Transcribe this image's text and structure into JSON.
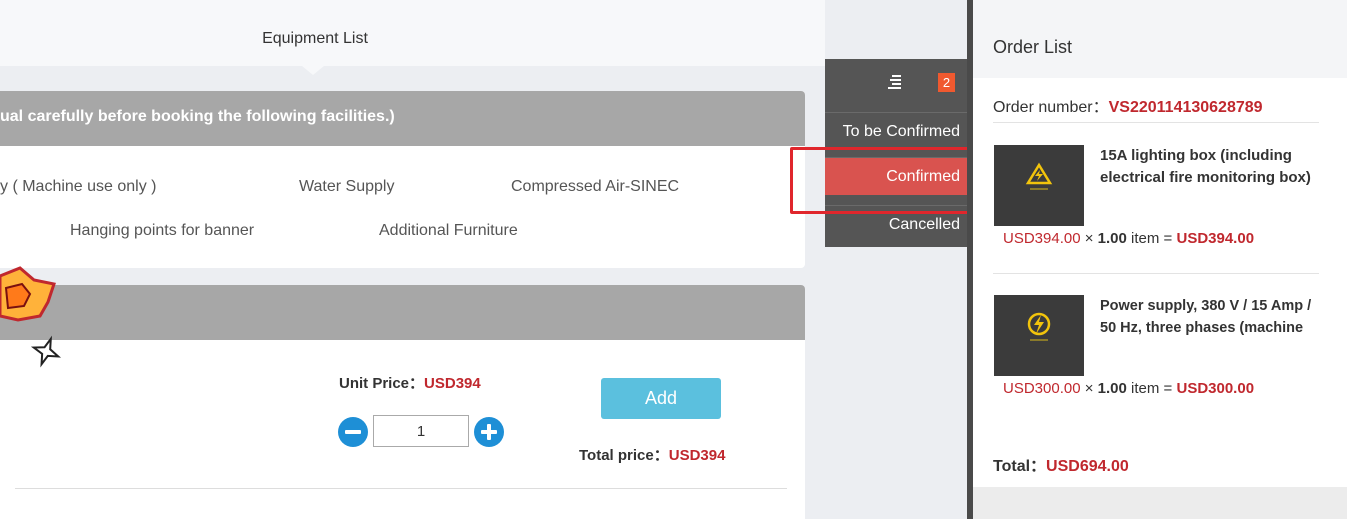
{
  "main": {
    "tab": "Equipment List",
    "notice": "ual carefully before booking the following facilities.)",
    "categories": [
      "y ( Machine use only )",
      "Water Supply",
      "Compressed Air-SINEC",
      "Hanging points for banner",
      "Additional Furniture"
    ],
    "product": {
      "unit_price_label": "Unit Price：",
      "unit_price": "USD394",
      "quantity": "1",
      "add_label": "Add",
      "total_price_label": "Total price：",
      "total_price": "USD394"
    }
  },
  "status_menu": {
    "badge": "2",
    "items": [
      "To be Confirmed",
      "Confirmed",
      "Cancelled"
    ],
    "active": "Confirmed"
  },
  "order_list": {
    "title": "Order List",
    "order_number_label": "Order number：",
    "order_number": "VS220114130628789",
    "items": [
      {
        "name": "15A lighting box (including electrical fire monitoring box)",
        "price": "USD394.00",
        "times": " × ",
        "qty": "1.00",
        "unit": " item = ",
        "subtotal": "USD394.00",
        "icon": "lightning-warning-icon"
      },
      {
        "name": "Power supply, 380 V / 15 Amp / 50 Hz, three phases (machine",
        "price": "USD300.00",
        "times": " × ",
        "qty": "1.00",
        "unit": " item = ",
        "subtotal": "USD300.00",
        "icon": "power-bolt-icon"
      }
    ],
    "total_label": "Total：",
    "total": "USD694.00"
  },
  "colors": {
    "accent_red": "#c0282e",
    "menu_active": "#d9534f",
    "add_button": "#5bc0de",
    "stepper": "#1e8fd6",
    "badge": "#f0592f"
  }
}
